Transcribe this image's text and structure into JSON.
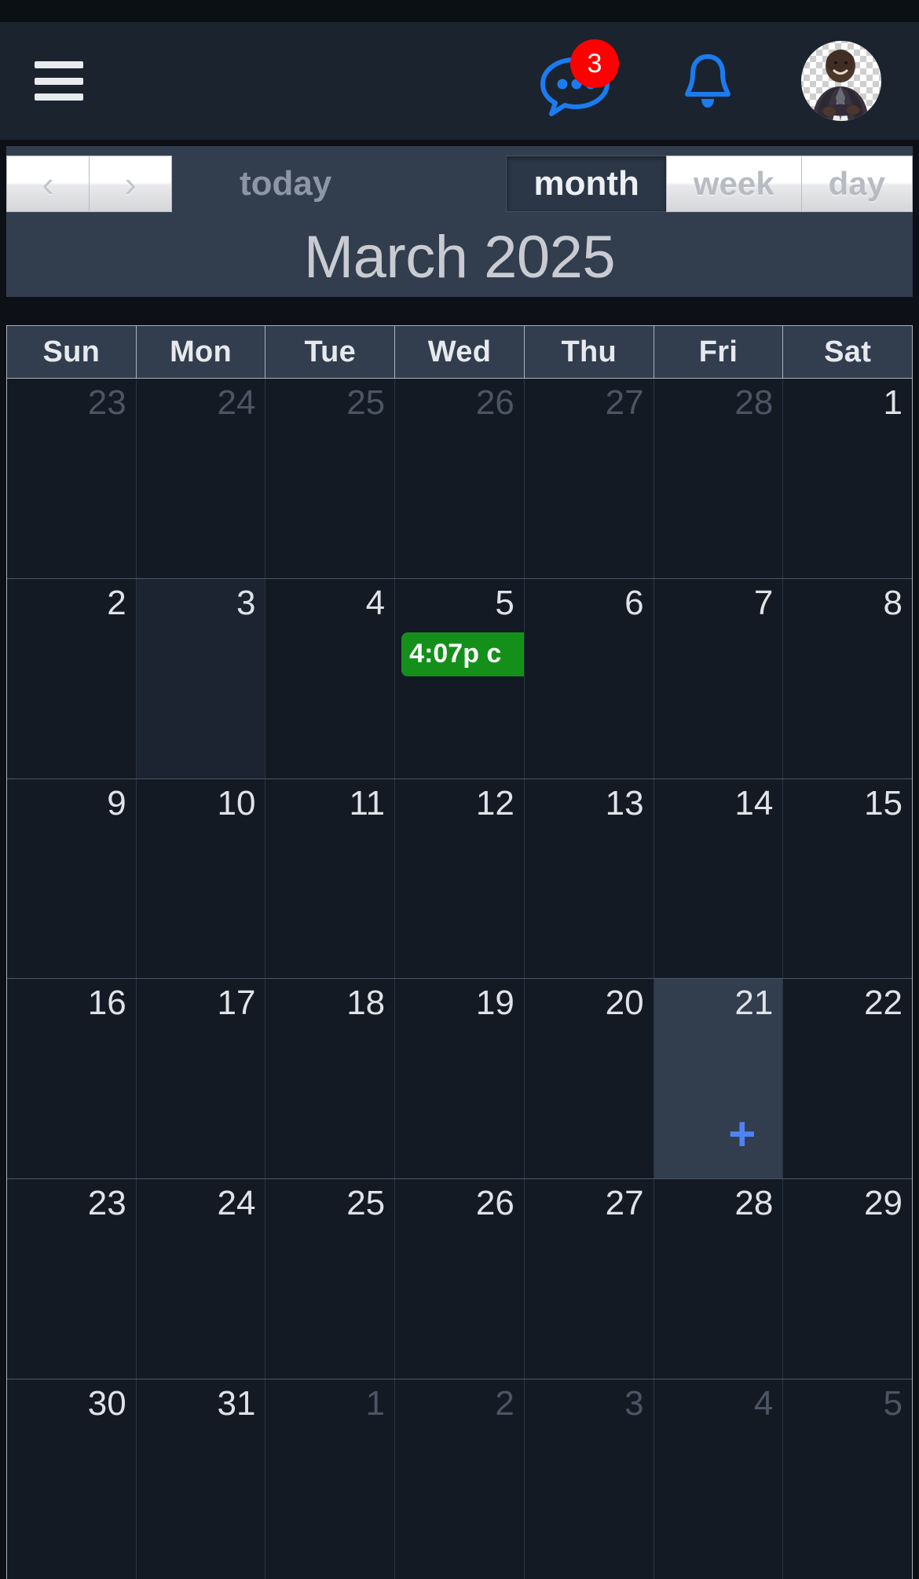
{
  "navbar": {
    "menu_icon": "hamburger-menu-icon",
    "chat": {
      "icon": "chat-bubble-icon",
      "badge_count": "3",
      "badge_color": "#ff0000",
      "icon_color": "#1a7cf0"
    },
    "notifications": {
      "icon": "bell-icon",
      "icon_color": "#1a7cf0"
    },
    "avatar": {
      "icon": "user-avatar",
      "alt": "Profile photo"
    },
    "background": "#1b232e"
  },
  "toolbar": {
    "prev_label": "‹",
    "next_label": "›",
    "today_label": "today",
    "views": [
      {
        "key": "month",
        "label": "month",
        "active": true
      },
      {
        "key": "week",
        "label": "week",
        "active": false
      },
      {
        "key": "day",
        "label": "day",
        "active": false
      }
    ],
    "title": "March 2025",
    "background": "#323d4e"
  },
  "calendar": {
    "weekday_headers": [
      "Sun",
      "Mon",
      "Tue",
      "Wed",
      "Thu",
      "Fri",
      "Sat"
    ],
    "event_color": "#14901a",
    "today_highlight_color": "#323d4e",
    "add_icon_color": "#4d84f5",
    "weeks": [
      {
        "days": [
          {
            "num": "23",
            "other": true
          },
          {
            "num": "24",
            "other": true
          },
          {
            "num": "25",
            "other": true
          },
          {
            "num": "26",
            "other": true
          },
          {
            "num": "27",
            "other": true
          },
          {
            "num": "28",
            "other": true
          },
          {
            "num": "1",
            "other": false
          }
        ]
      },
      {
        "days": [
          {
            "num": "2",
            "other": false
          },
          {
            "num": "3",
            "other": false,
            "highlight": true
          },
          {
            "num": "4",
            "other": false
          },
          {
            "num": "5",
            "other": false,
            "events": [
              {
                "time": "4:07p",
                "title": "c",
                "text": "4:07p c"
              }
            ]
          },
          {
            "num": "6",
            "other": false
          },
          {
            "num": "7",
            "other": false
          },
          {
            "num": "8",
            "other": false
          }
        ]
      },
      {
        "days": [
          {
            "num": "9",
            "other": false
          },
          {
            "num": "10",
            "other": false
          },
          {
            "num": "11",
            "other": false
          },
          {
            "num": "12",
            "other": false
          },
          {
            "num": "13",
            "other": false
          },
          {
            "num": "14",
            "other": false
          },
          {
            "num": "15",
            "other": false
          }
        ]
      },
      {
        "days": [
          {
            "num": "16",
            "other": false
          },
          {
            "num": "17",
            "other": false
          },
          {
            "num": "18",
            "other": false
          },
          {
            "num": "19",
            "other": false
          },
          {
            "num": "20",
            "other": false
          },
          {
            "num": "21",
            "other": false,
            "today": true,
            "add_label": "+"
          },
          {
            "num": "22",
            "other": false
          }
        ]
      },
      {
        "days": [
          {
            "num": "23",
            "other": false
          },
          {
            "num": "24",
            "other": false
          },
          {
            "num": "25",
            "other": false
          },
          {
            "num": "26",
            "other": false
          },
          {
            "num": "27",
            "other": false
          },
          {
            "num": "28",
            "other": false
          },
          {
            "num": "29",
            "other": false
          }
        ]
      },
      {
        "days": [
          {
            "num": "30",
            "other": false
          },
          {
            "num": "31",
            "other": false
          },
          {
            "num": "1",
            "other": true
          },
          {
            "num": "2",
            "other": true
          },
          {
            "num": "3",
            "other": true
          },
          {
            "num": "4",
            "other": true
          },
          {
            "num": "5",
            "other": true
          }
        ]
      }
    ]
  }
}
